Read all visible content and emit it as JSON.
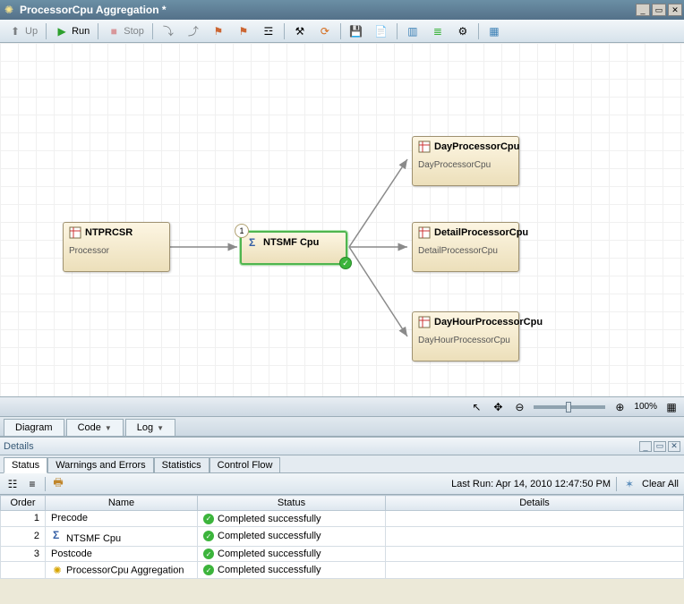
{
  "window": {
    "title": "ProcessorCpu Aggregation *"
  },
  "toolbar": {
    "up_label": "Up",
    "run_label": "Run",
    "stop_label": "Stop"
  },
  "diagram": {
    "nodes": {
      "ntprcsr": {
        "title": "NTPRCSR",
        "subtitle": "Processor"
      },
      "ntsmf": {
        "title": "NTSMF Cpu",
        "badge_number": "1"
      },
      "dayproc": {
        "title": "DayProcessorCpu",
        "subtitle": "DayProcessorCpu"
      },
      "detailproc": {
        "title": "DetailProcessorCpu",
        "subtitle": "DetailProcessorCpu"
      },
      "dayhour": {
        "title": "DayHourProcessorCpu",
        "subtitle": "DayHourProcessorCpu"
      }
    },
    "zoom_label": "100%"
  },
  "view_tabs": {
    "diagram": "Diagram",
    "code": "Code",
    "log": "Log"
  },
  "details": {
    "title": "Details",
    "tabs": {
      "status": "Status",
      "warnings": "Warnings and Errors",
      "statistics": "Statistics",
      "control_flow": "Control Flow"
    },
    "last_run_label": "Last Run: Apr 14, 2010 12:47:50 PM",
    "clear_label": "Clear All",
    "columns": {
      "order": "Order",
      "name": "Name",
      "status": "Status",
      "details": "Details"
    },
    "rows": [
      {
        "order": "1",
        "name": "Precode",
        "status": "Completed successfully",
        "details": "",
        "icon": ""
      },
      {
        "order": "2",
        "name": "NTSMF Cpu",
        "status": "Completed successfully",
        "details": "",
        "icon": "sigma"
      },
      {
        "order": "3",
        "name": "Postcode",
        "status": "Completed successfully",
        "details": "",
        "icon": ""
      },
      {
        "order": "",
        "name": "ProcessorCpu Aggregation",
        "status": "Completed successfully",
        "details": "",
        "icon": "gear"
      }
    ]
  }
}
